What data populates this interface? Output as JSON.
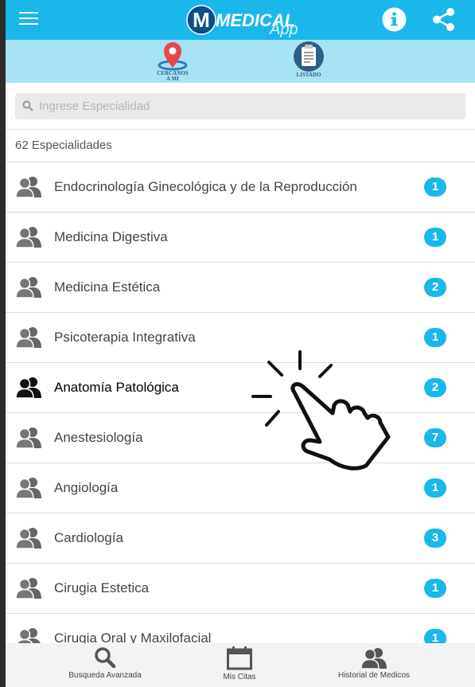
{
  "header": {
    "logo_text_main": "MEDICAL",
    "logo_text_sub": "App",
    "logo_letter": "M",
    "menu_icon": "hamburger-icon",
    "info_icon": "info-icon",
    "share_icon": "share-icon",
    "color": "#1ab7ea"
  },
  "quickbar": {
    "color": "#a8e2f5",
    "items": [
      {
        "label_line1": "CERCANOS",
        "label_line2": "A MI",
        "icon": "map-pin-icon"
      },
      {
        "label": "LISTADO",
        "icon": "clipboard-icon"
      }
    ]
  },
  "search": {
    "placeholder": "Ingrese Especialidad",
    "value": ""
  },
  "count_text": "62 Especialidades",
  "specialties": [
    {
      "name": "Endocrinología Ginecológica y de la Reproducción",
      "count": "1"
    },
    {
      "name": "Medicina Digestiva",
      "count": "1"
    },
    {
      "name": "Medicina Estética",
      "count": "2"
    },
    {
      "name": "Psicoterapia Integrativa",
      "count": "1"
    },
    {
      "name": "Anatomía Patológica",
      "count": "2",
      "highlighted": true
    },
    {
      "name": "Anestesiología",
      "count": "7"
    },
    {
      "name": "Angiología",
      "count": "1"
    },
    {
      "name": "Cardiología",
      "count": "3"
    },
    {
      "name": "Cirugia Estetica",
      "count": "1"
    },
    {
      "name": "Cirugia Oral y Maxilofacial",
      "count": "1"
    }
  ],
  "bottom_nav": [
    {
      "label": "Busqueda Avanzada",
      "icon": "search-icon"
    },
    {
      "label": "Mis Citas",
      "icon": "calendar-icon"
    },
    {
      "label": "Historial de Medicos",
      "icon": "doctors-icon"
    }
  ]
}
